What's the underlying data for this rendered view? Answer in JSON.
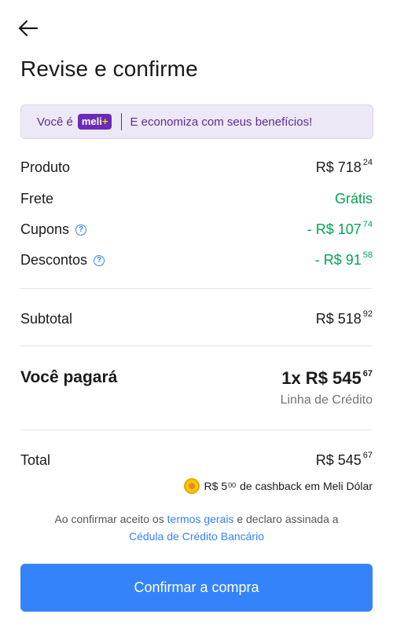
{
  "header": {
    "title": "Revise e confirme"
  },
  "banner": {
    "prefix": "Você é",
    "badge_main": "meli",
    "badge_plus": "+",
    "text": "E economiza com seus benefícios!"
  },
  "summary": {
    "produto": {
      "label": "Produto",
      "main": "R$ 718",
      "cents": "24"
    },
    "frete": {
      "label": "Frete",
      "main": "Grátis"
    },
    "cupons": {
      "label": "Cupons",
      "main": "- R$ 107",
      "cents": "74"
    },
    "descontos": {
      "label": "Descontos",
      "main": "- R$ 91",
      "cents": "58"
    },
    "subtotal": {
      "label": "Subtotal",
      "main": "R$ 518",
      "cents": "92"
    }
  },
  "payment": {
    "label": "Você pagará",
    "main": "1x R$ 545",
    "cents": "67",
    "method": "Linha de Crédito"
  },
  "total": {
    "label": "Total",
    "main": "R$ 545",
    "cents": "67"
  },
  "cashback": {
    "amount_main": "R$ 5",
    "amount_cents": "00",
    "text": "de cashback em Meli Dólar"
  },
  "legal": {
    "part1": "Ao confirmar aceito os",
    "link1": "termos gerais",
    "part2": "e declaro assinada a",
    "link2": "Cédula de Crédito Bancário"
  },
  "cta": {
    "label": "Confirmar a compra",
    "color": "#3483fa"
  },
  "colors": {
    "discount_green": "#00a650",
    "meli_plus_purple": "#6b2bb6"
  }
}
